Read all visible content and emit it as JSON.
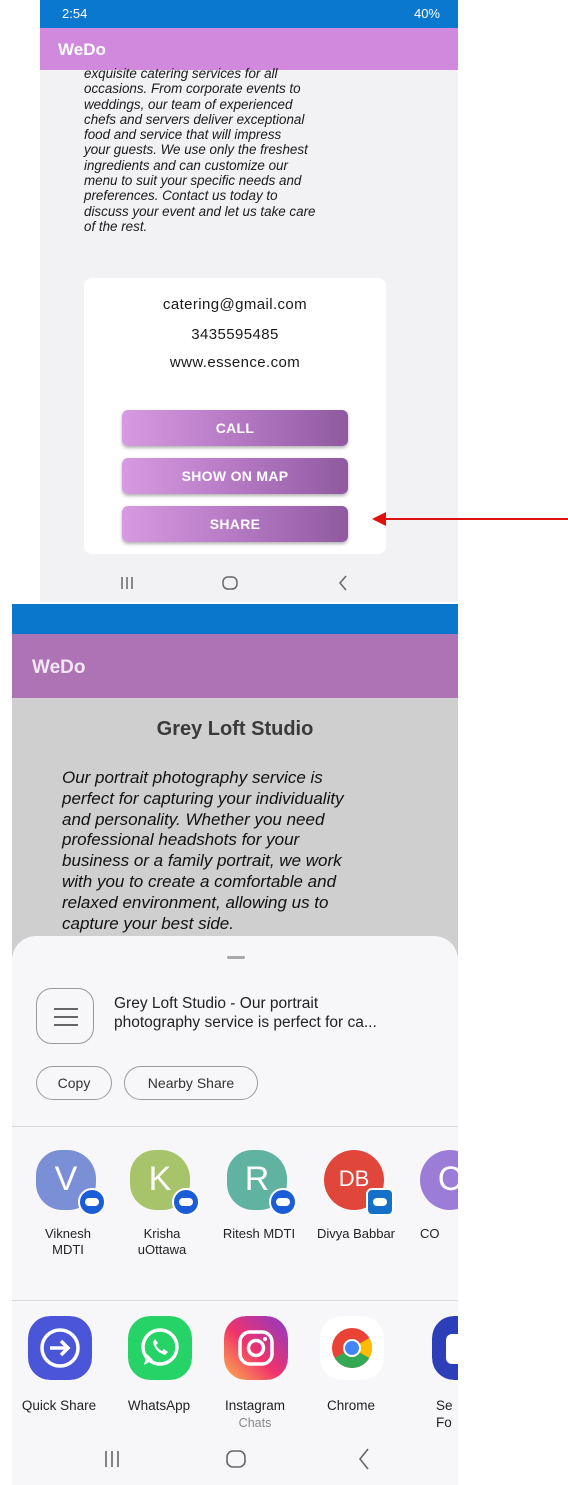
{
  "screen1": {
    "status": {
      "time": "2:54",
      "battery": "40%"
    },
    "app_title": "WeDo",
    "description_lines": [
      "exquisite catering services for all",
      "occasions. From corporate events to",
      "weddings, our team of experienced",
      "chefs and servers deliver exceptional",
      "food and service that will impress",
      "your guests. We use only the freshest",
      "ingredients and can customize our",
      "menu to suit your specific needs and",
      "preferences. Contact us today to",
      "discuss your event and let us take care",
      "of the rest."
    ],
    "contact": {
      "email": "catering@gmail.com",
      "phone": "3435595485",
      "website": "www.essence.com"
    },
    "buttons": {
      "call": "CALL",
      "map": "SHOW ON MAP",
      "share": "SHARE"
    },
    "colors": {
      "appbar": "#d189dd",
      "status": "#0b78cf",
      "button_start": "#d79ae2",
      "button_end": "#8f5aa0",
      "annotation_arrow": "#e01010"
    }
  },
  "screen2": {
    "app_title": "WeDo",
    "heading": "Grey Loft Studio",
    "description_lines": [
      "Our portrait photography service is",
      "perfect for capturing your individuality",
      "and personality. Whether you need",
      "professional headshots for your",
      "business or a family portrait, we work",
      "with you to create a comfortable and",
      "relaxed environment, allowing us to",
      "capture your best side."
    ],
    "share_sheet": {
      "preview_line1": "Grey Loft Studio - Our portrait",
      "preview_line2": "photography service is perfect for ca...",
      "chips": {
        "copy": "Copy",
        "nearby": "Nearby Share"
      },
      "contacts": [
        {
          "initial": "V",
          "name_line1": "Viknesh",
          "name_line2": "MDTI",
          "color": "#7b8fd6"
        },
        {
          "initial": "K",
          "name_line1": "Krisha",
          "name_line2": "uOttawa",
          "color": "#a8c46a"
        },
        {
          "initial": "R",
          "name_line1": "Ritesh MDTI",
          "name_line2": "",
          "color": "#5fb3a0"
        },
        {
          "initial": "DB",
          "name_line1": "Divya Babbar",
          "name_line2": "",
          "color": "#e0463a"
        },
        {
          "initial": "C",
          "name_line1": "CO",
          "name_line2": "",
          "color": "#9b7cd6"
        }
      ],
      "apps": [
        {
          "name": "Quick Share",
          "sub": "",
          "icon": "quick-share-icon"
        },
        {
          "name": "WhatsApp",
          "sub": "",
          "icon": "whatsapp-icon"
        },
        {
          "name": "Instagram",
          "sub": "Chats",
          "icon": "instagram-icon"
        },
        {
          "name": "Chrome",
          "sub": "",
          "icon": "chrome-icon"
        },
        {
          "name": "Se",
          "sub": "Fo",
          "icon": "secure-folder-icon"
        }
      ]
    },
    "colors": {
      "appbar": "#ad73b5",
      "status": "#0a77cc",
      "background": "#cfcfcf"
    }
  }
}
